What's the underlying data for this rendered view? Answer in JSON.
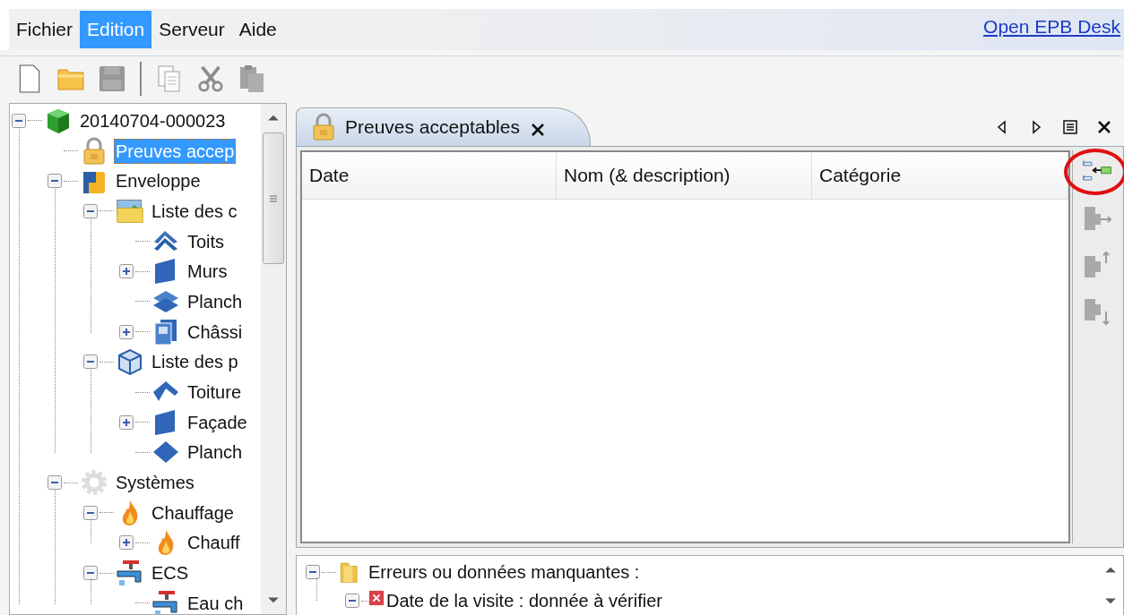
{
  "menu": [
    {
      "label": "Fichier",
      "selected": false
    },
    {
      "label": "Edition",
      "selected": true
    },
    {
      "label": "Serveur",
      "selected": false
    },
    {
      "label": "Aide",
      "selected": false
    }
  ],
  "header_link": "Open EPB Desk",
  "toolbar": [
    {
      "kind": "new",
      "disabled": false
    },
    {
      "kind": "open",
      "disabled": false
    },
    {
      "kind": "save",
      "disabled": true
    },
    {
      "kind": "separator"
    },
    {
      "kind": "copy",
      "disabled": true
    },
    {
      "kind": "cut",
      "disabled": true
    },
    {
      "kind": "paste",
      "disabled": true
    }
  ],
  "tree": [
    {
      "label": "20140704-000023",
      "kind": "project",
      "selected": false,
      "expanded": true,
      "children": [
        {
          "label": "Preuves accep",
          "kind": "lock",
          "selected": true
        },
        {
          "label": "Enveloppe",
          "kind": "envelope",
          "selected": false,
          "expanded": true,
          "children": [
            {
              "label": "Liste des c",
              "kind": "picture-folder",
              "selected": false,
              "expanded": true,
              "children": [
                {
                  "label": "Toits",
                  "kind": "roofs",
                  "selected": false
                },
                {
                  "label": "Murs",
                  "kind": "wall",
                  "selected": false,
                  "expanded": false
                },
                {
                  "label": "Planch",
                  "kind": "floors",
                  "selected": false
                },
                {
                  "label": "Châssi",
                  "kind": "window",
                  "selected": false,
                  "expanded": false
                }
              ]
            },
            {
              "label": "Liste des p",
              "kind": "box",
              "selected": false,
              "expanded": true,
              "children": [
                {
                  "label": "Toiture",
                  "kind": "roof",
                  "selected": false
                },
                {
                  "label": "Façade",
                  "kind": "wall",
                  "selected": false,
                  "expanded": false
                },
                {
                  "label": "Planch",
                  "kind": "floor",
                  "selected": false
                }
              ]
            }
          ]
        },
        {
          "label": "Systèmes",
          "kind": "gear",
          "selected": false,
          "expanded": true,
          "children": [
            {
              "label": "Chauffage",
              "kind": "flame",
              "selected": false,
              "expanded": true,
              "children": [
                {
                  "label": "Chauff",
                  "kind": "flame",
                  "selected": false,
                  "expanded": false
                }
              ]
            },
            {
              "label": "ECS",
              "kind": "tap",
              "selected": false,
              "expanded": true,
              "children": [
                {
                  "label": "Eau ch",
                  "kind": "tap",
                  "selected": false
                }
              ]
            }
          ]
        }
      ]
    }
  ],
  "editor": {
    "tab": {
      "label": "Preuves acceptables",
      "kind": "lock"
    },
    "columns": [
      "Date",
      "Nom (& description)",
      "Catégorie"
    ],
    "side_tools": [
      {
        "kind": "link",
        "disabled": false,
        "highlighted": true
      },
      {
        "kind": "right",
        "disabled": true,
        "highlighted": false
      },
      {
        "kind": "up",
        "disabled": true,
        "highlighted": false
      },
      {
        "kind": "down",
        "disabled": true,
        "highlighted": false
      }
    ]
  },
  "problems": [
    {
      "label": "Erreurs ou données manquantes :",
      "kind": "folder",
      "expanded": true,
      "children": [
        {
          "label": "Date de la visite : donnée à vérifier",
          "kind": "error",
          "expanded": true
        }
      ]
    }
  ]
}
